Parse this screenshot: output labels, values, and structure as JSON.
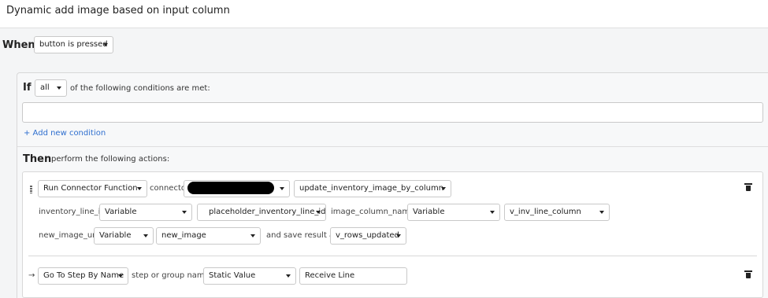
{
  "page": {
    "title": "Dynamic add image based on input column"
  },
  "when": {
    "label": "When",
    "trigger": "button is pressed"
  },
  "if": {
    "label": "If",
    "match": "all",
    "suffix": "of the following conditions are met:",
    "add_condition": "+ Add new condition"
  },
  "then": {
    "label": "Then",
    "suffix": "perform the following actions:"
  },
  "action1": {
    "type": "Run Connector Function",
    "connector_label": "connector",
    "function": "update_inventory_image_by_column",
    "inventory_line_id_label": "inventory_line_id:",
    "inventory_line_id_source": "Variable",
    "inventory_line_id_value": "placeholder_inventory_line_id",
    "image_column_name_label": "image_column_name:",
    "image_column_name_source": "Variable",
    "image_column_name_value": "v_inv_line_column",
    "new_image_url_label": "new_image_url:",
    "new_image_url_source": "Variable",
    "new_image_url_value": "new_image",
    "save_label": "and save result as:",
    "save_value": "v_rows_updated"
  },
  "action2": {
    "type": "Go To Step By Name",
    "step_label": "step or group name:",
    "step_source": "Static Value",
    "step_value": "Receive Line"
  },
  "icons": {
    "drag": "drag-handle-icon",
    "arrow": "arrow-right-icon",
    "trash": "trash-icon",
    "caret": "caret-down-icon"
  }
}
